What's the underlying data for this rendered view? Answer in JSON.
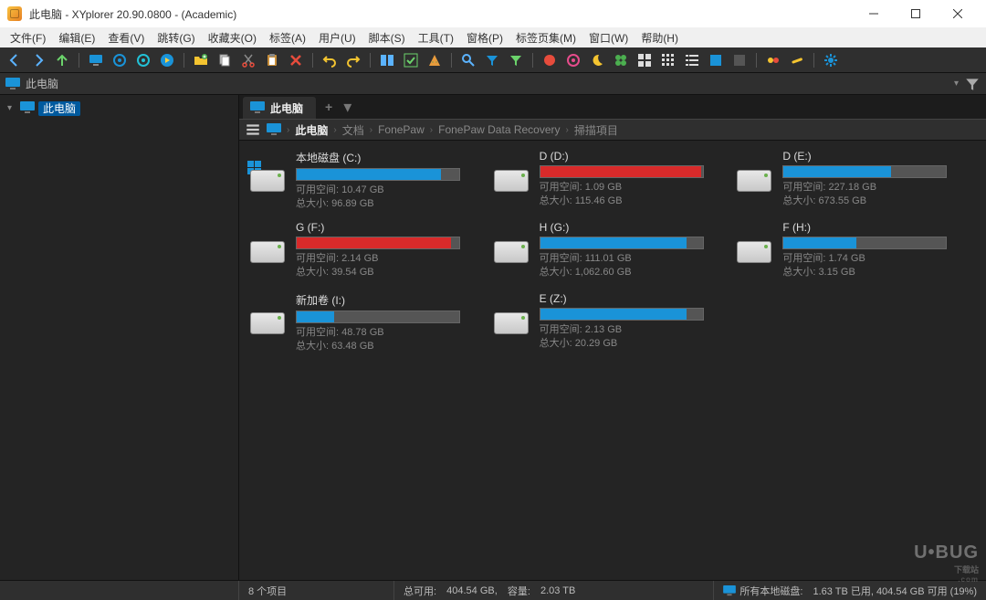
{
  "window": {
    "title": "此电脑 - XYplorer 20.90.0800 - (Academic)"
  },
  "menu": [
    "文件(F)",
    "编辑(E)",
    "查看(V)",
    "跳转(G)",
    "收藏夹(O)",
    "标签(A)",
    "用户(U)",
    "脚本(S)",
    "工具(T)",
    "窗格(P)",
    "标签页集(M)",
    "窗口(W)",
    "帮助(H)"
  ],
  "addressbar": {
    "path": "此电脑"
  },
  "tree": {
    "root": "此电脑"
  },
  "tab": {
    "label": "此电脑"
  },
  "breadcrumb": {
    "root": "此电脑",
    "segs": [
      "文档",
      "FonePaw",
      "FonePaw Data Recovery",
      "掃描項目"
    ]
  },
  "drives": [
    {
      "name": "本地磁盘 (C:)",
      "free_label": "可用空间:",
      "free": "10.47 GB",
      "total_label": "总大小:",
      "total": "96.89 GB",
      "fill": 89,
      "critical": false,
      "winlogo": true
    },
    {
      "name": "D (D:)",
      "free_label": "可用空间:",
      "free": "1.09 GB",
      "total_label": "总大小:",
      "total": "115.46 GB",
      "fill": 99,
      "critical": true
    },
    {
      "name": "D (E:)",
      "free_label": "可用空间:",
      "free": "227.18 GB",
      "total_label": "总大小:",
      "total": "673.55 GB",
      "fill": 66,
      "critical": false
    },
    {
      "name": "G (F:)",
      "free_label": "可用空间:",
      "free": "2.14 GB",
      "total_label": "总大小:",
      "total": "39.54 GB",
      "fill": 95,
      "critical": true
    },
    {
      "name": "H (G:)",
      "free_label": "可用空间:",
      "free": "111.01 GB",
      "total_label": "总大小:",
      "total": "1,062.60 GB",
      "fill": 90,
      "critical": false
    },
    {
      "name": "F (H:)",
      "free_label": "可用空间:",
      "free": "1.74 GB",
      "total_label": "总大小:",
      "total": "3.15 GB",
      "fill": 45,
      "critical": false
    },
    {
      "name": "新加卷 (I:)",
      "free_label": "可用空间:",
      "free": "48.78 GB",
      "total_label": "总大小:",
      "total": "63.48 GB",
      "fill": 23,
      "critical": false
    },
    {
      "name": "E (Z:)",
      "free_label": "可用空间:",
      "free": "2.13 GB",
      "total_label": "总大小:",
      "total": "20.29 GB",
      "fill": 90,
      "critical": false
    }
  ],
  "status": {
    "items": "8 个项目",
    "totals_label": "总可用:",
    "totals_free": "404.54 GB,",
    "cap_label": "容量:",
    "cap": "2.03 TB",
    "local_label": "所有本地磁盘:",
    "local": "1.63 TB 已用, 404.54 GB 可用 (19%)"
  },
  "watermark": {
    "brand": "U•BUG",
    "sub": "下载站",
    "sub2": ".com"
  }
}
